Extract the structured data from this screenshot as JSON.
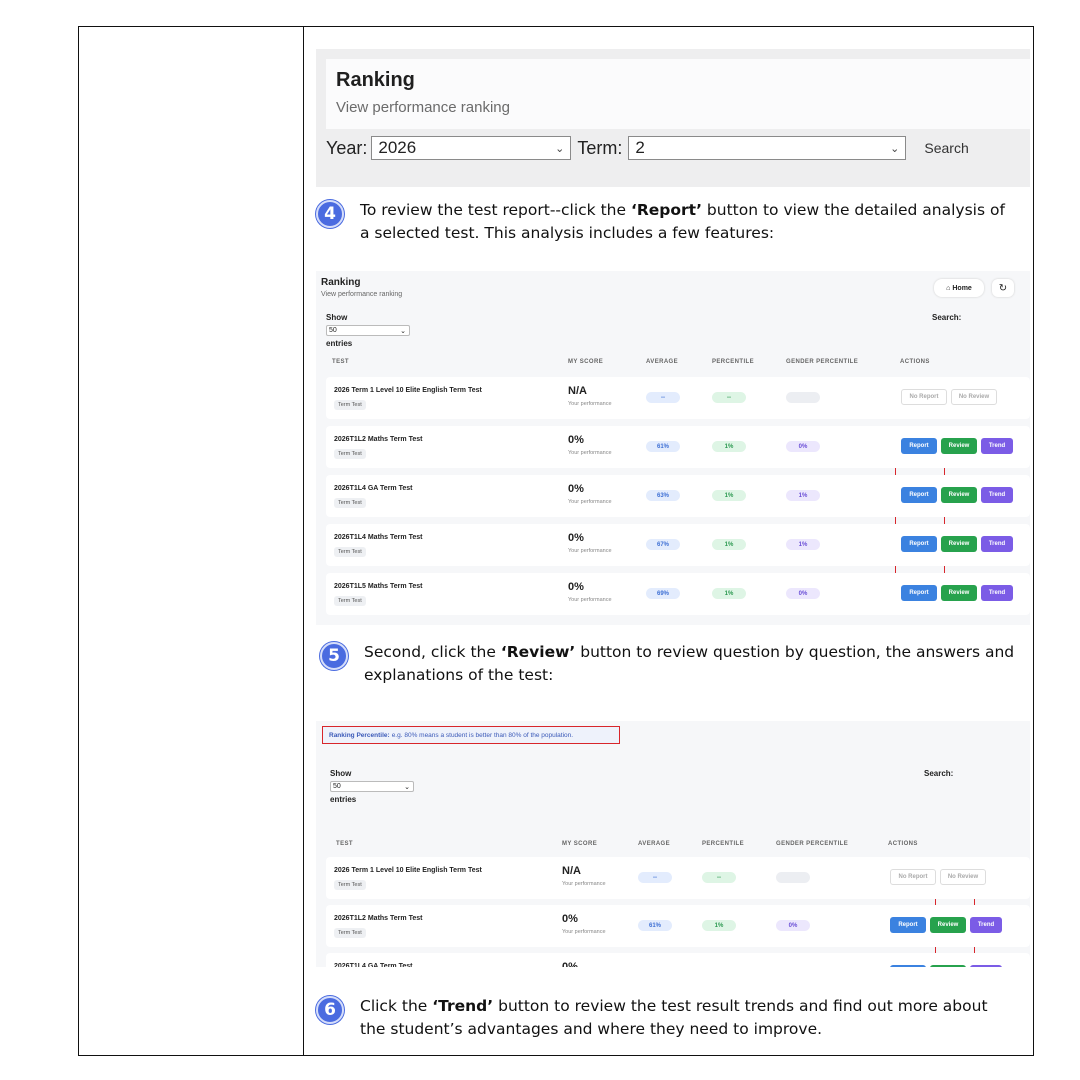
{
  "shot1": {
    "title": "Ranking",
    "subtitle": "View performance ranking",
    "year_label": "Year:",
    "year_value": "2026",
    "term_label": "Term:",
    "term_value": "2",
    "search_label": "Search"
  },
  "step4": {
    "number": "4",
    "text_before": "To review the test report--click the ",
    "bold": "‘Report’",
    "text_after": " button to view the detailed analysis of a selected test. This analysis includes a few features:"
  },
  "step5": {
    "number": "5",
    "text_before": "Second, click the ",
    "bold": "‘Review’",
    "text_after": " button to review question by question, the answers and explanations of the test:"
  },
  "step6": {
    "number": "6",
    "text_before": "Click the ",
    "bold": "‘Trend’",
    "text_after": " button to review the test result trends and find out more about the student’s advantages and where they need to improve."
  },
  "ranking": {
    "title": "Ranking",
    "subtitle": "View performance ranking",
    "home_label": "Home",
    "show_label": "Show",
    "entries_value": "50",
    "entries_label": "entries",
    "search_label": "Search:",
    "notice_bold": "Ranking Percentile:",
    "notice_text": "e.g. 80% means a student is better than 80% of the population.",
    "headers": {
      "test": "TEST",
      "my_score": "MY SCORE",
      "average": "AVERAGE",
      "percentile": "PERCENTILE",
      "gender": "GENDER PERCENTILE",
      "actions": "ACTIONS"
    },
    "tag": "Term Test",
    "perf_label": "Your performance",
    "btn_report": "Report",
    "btn_review": "Review",
    "btn_trend": "Trend",
    "btn_no_report": "No Report",
    "btn_no_review": "No Review",
    "rows": [
      {
        "name": "2026 Term 1 Level 10 Elite English Term Test",
        "score": "N/A",
        "average": "--",
        "percentile": "--",
        "gender": ""
      },
      {
        "name": "2026T1L2 Maths Term Test",
        "score": "0%",
        "average": "61%",
        "percentile": "1%",
        "gender": "0%"
      },
      {
        "name": "2026T1L4 GA Term Test",
        "score": "0%",
        "average": "63%",
        "percentile": "1%",
        "gender": "1%"
      },
      {
        "name": "2026T1L4 Maths Term Test",
        "score": "0%",
        "average": "67%",
        "percentile": "1%",
        "gender": "1%"
      },
      {
        "name": "2026T1L5 Maths Term Test",
        "score": "0%",
        "average": "69%",
        "percentile": "1%",
        "gender": "0%"
      }
    ]
  }
}
